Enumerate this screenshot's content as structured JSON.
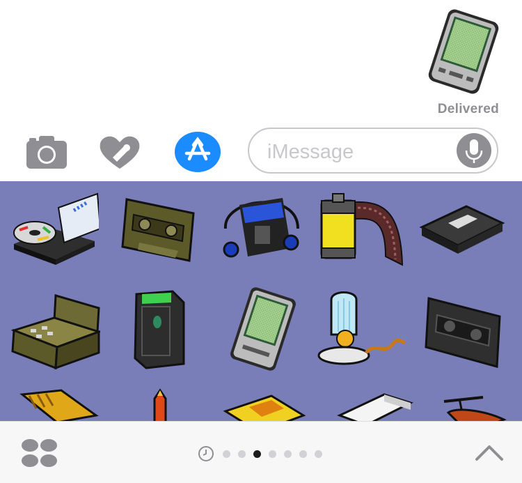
{
  "thread": {
    "sent_sticker": "pda-sticker",
    "status": "Delivered"
  },
  "composer": {
    "camera_icon": "camera-icon",
    "digital_touch_icon": "heart-hand-icon",
    "app_store_icon": "app-store-icon",
    "input_placeholder": "iMessage",
    "input_value": "",
    "mic_icon": "microphone-icon",
    "accent_color": "#1a8cff"
  },
  "drawer": {
    "background": "#7a7eb8",
    "stickers": [
      "cd-player",
      "audio-cassette",
      "portable-cassette-player",
      "film-roll",
      "vhs-tape",
      "cash-register",
      "pager-device",
      "pda",
      "desk-lamp-bulb",
      "dark-cassette",
      "keyboard-partial",
      "pencil-partial",
      "ruler-partial",
      "eraser-partial",
      "helicopter-partial"
    ]
  },
  "tray": {
    "apps_icon": "app-drawer-icon",
    "recents_icon": "clock-icon",
    "page_count": 7,
    "active_page": 3,
    "expand_icon": "chevron-up-icon"
  }
}
